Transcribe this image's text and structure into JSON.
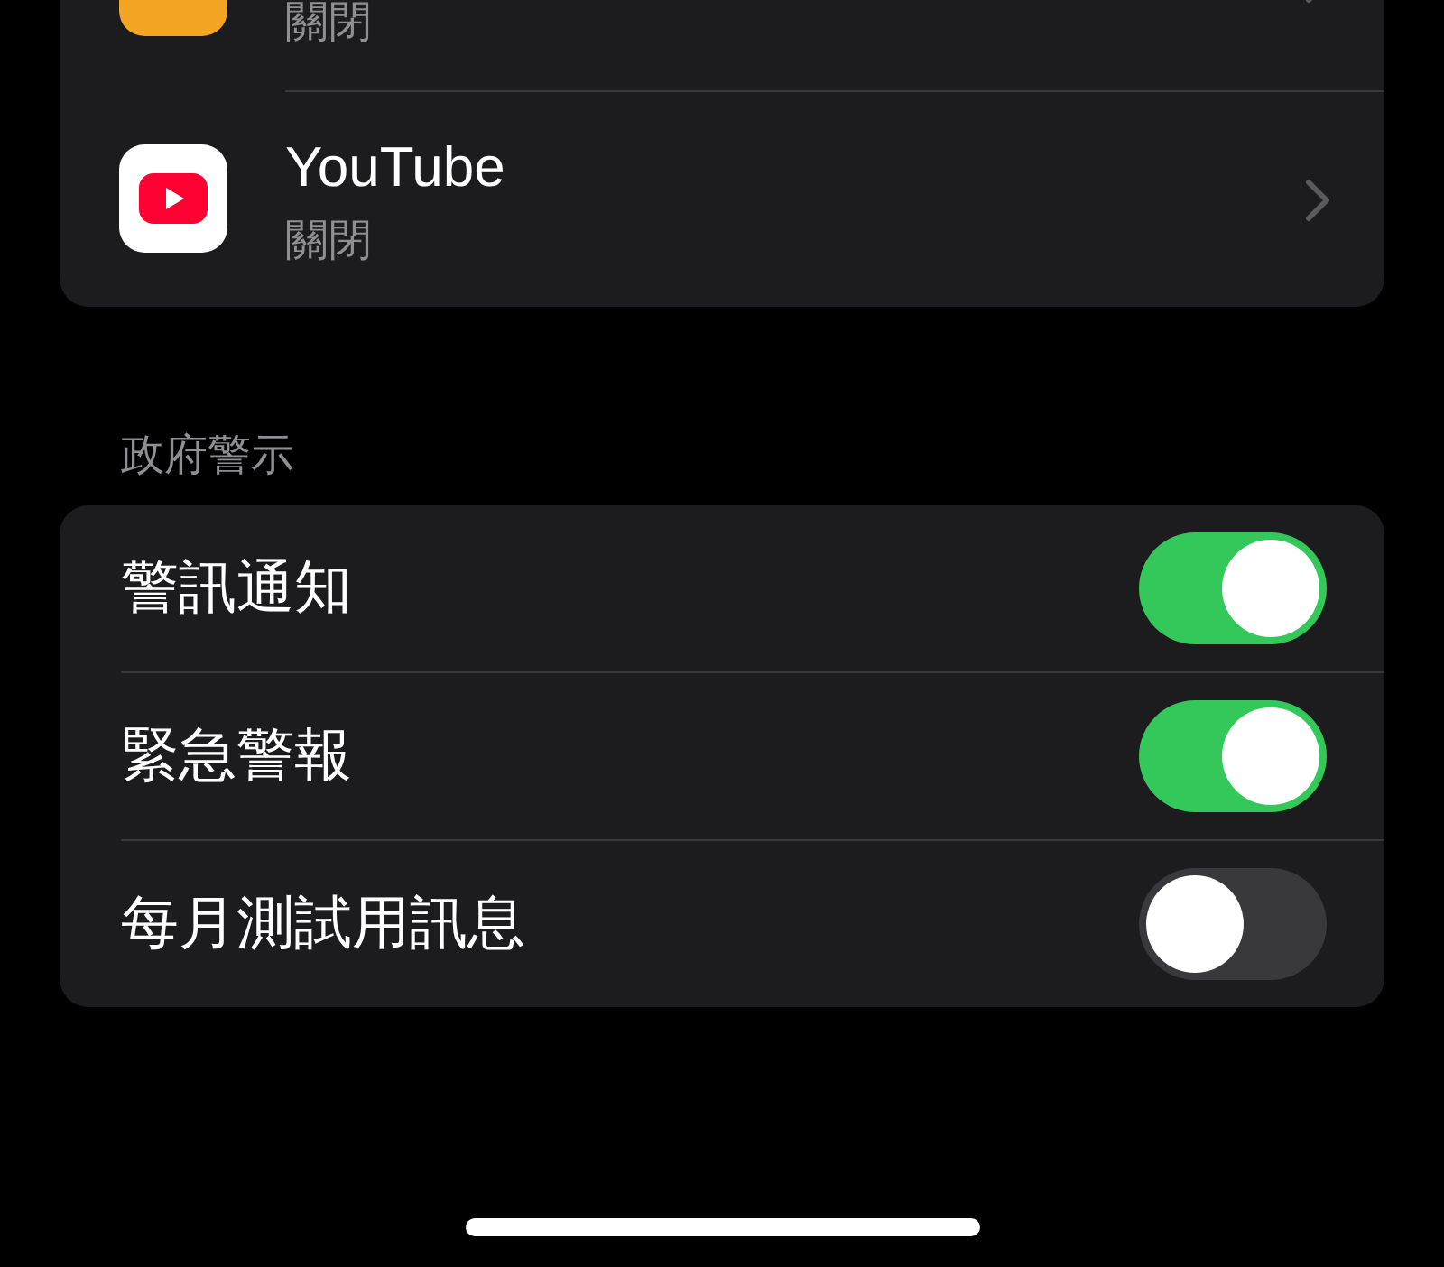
{
  "apps": [
    {
      "subtitle": "關閉"
    },
    {
      "title": "YouTube",
      "subtitle": "關閉"
    }
  ],
  "government_alerts": {
    "header": "政府警示",
    "rows": [
      {
        "label": "警訊通知",
        "on": true
      },
      {
        "label": "緊急警報",
        "on": true
      },
      {
        "label": "每月測試用訊息",
        "on": false
      }
    ]
  }
}
